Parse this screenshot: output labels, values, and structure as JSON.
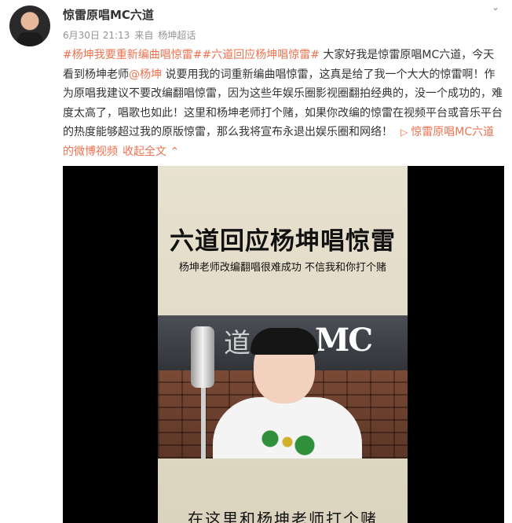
{
  "header": {
    "username": "惊雷原唱MC六道",
    "date": "6月30日 21:13",
    "source_prefix": "来自",
    "source": "杨坤超话",
    "menu_icon": "chevron-down-icon"
  },
  "post": {
    "hashtag1": "#杨坤我要重新编曲唱惊雷#",
    "hashtag2": "#六道回应杨坤唱惊雷#",
    "text1": " 大家好我是惊雷原唱MC六道，今天看到杨坤老师",
    "mention": "@杨坤",
    "text2": " 说要用我的词重新编曲唱惊雷，这真是给了我一个大大的惊雷啊！作为原唱我建议不要改编翻唱惊雷，因为这些年娱乐圈影视圈翻拍经典的，没一个成功的，难度太高了，唱歌也如此！这里和杨坤老师打个赌，如果你改编的惊雷在视频平台或音乐平台的热度能够超过我的原版惊雷，那么我将宣布永退出娱乐圈和网络！",
    "video_link": "惊雷原唱MC六道的微博视频",
    "collapse": "收起全文",
    "accent_color": "#eb7350"
  },
  "video": {
    "title": "六道回应杨坤唱惊雷",
    "subtitle": "杨坤老师改编翻唱很难成功  不信我和你打个赌",
    "logo": "MC",
    "caption": "在这里和杨坤老师打个赌"
  }
}
